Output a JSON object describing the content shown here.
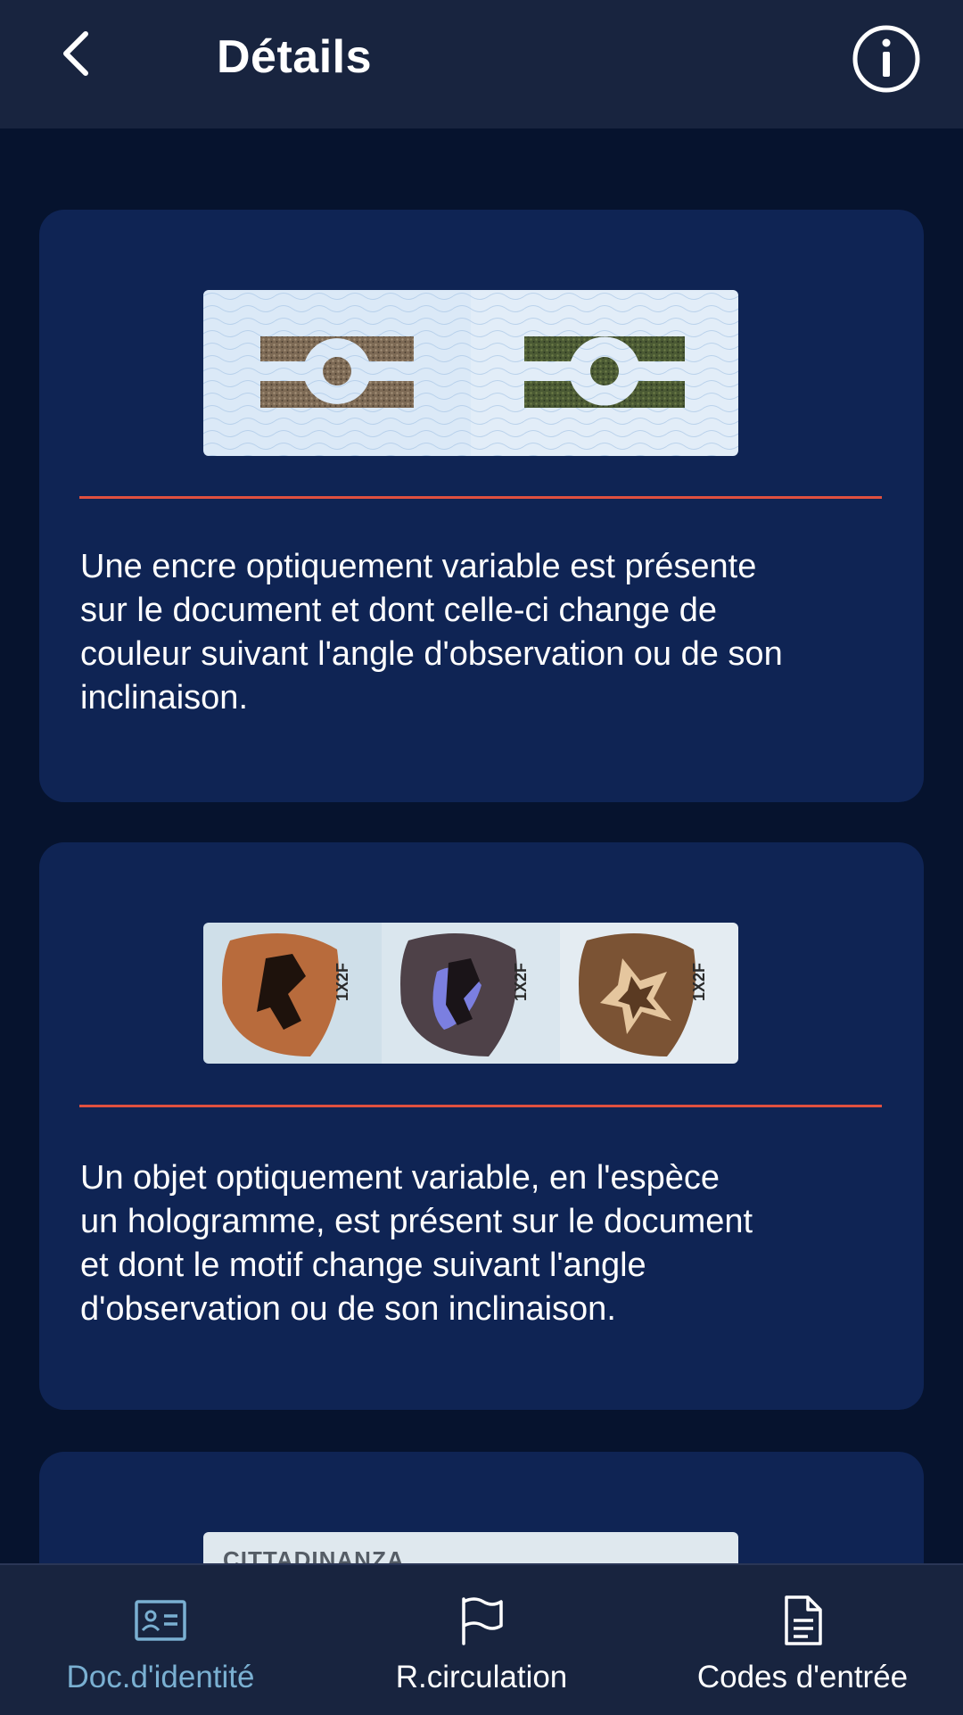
{
  "header": {
    "title": "Détails"
  },
  "cards": [
    {
      "description": "Une encre optiquement variable est présente\nsur le document et dont celle-ci change de\ncouleur suivant l'angle d'observation ou de son\ninclinaison."
    },
    {
      "description": "Un objet optiquement variable, en l'espèce\nun hologramme, est présent sur le document\net dont le motif change suivant l'angle\nd'observation ou de son inclinaison.",
      "hologram_code": "1X2F"
    },
    {
      "partial_text": "CITTADINANZA"
    }
  ],
  "bottom_nav": {
    "items": [
      {
        "label": "Doc.d'identité",
        "icon": "id-card-icon",
        "active": true
      },
      {
        "label": "R.circulation",
        "icon": "flag-icon",
        "active": false
      },
      {
        "label": "Codes d'entrée",
        "icon": "document-icon",
        "active": false
      }
    ]
  },
  "colors": {
    "background": "#06132e",
    "bar": "#18243f",
    "card": "#0f2454",
    "divider": "#e0503f",
    "active_nav": "#7ab0d2"
  }
}
